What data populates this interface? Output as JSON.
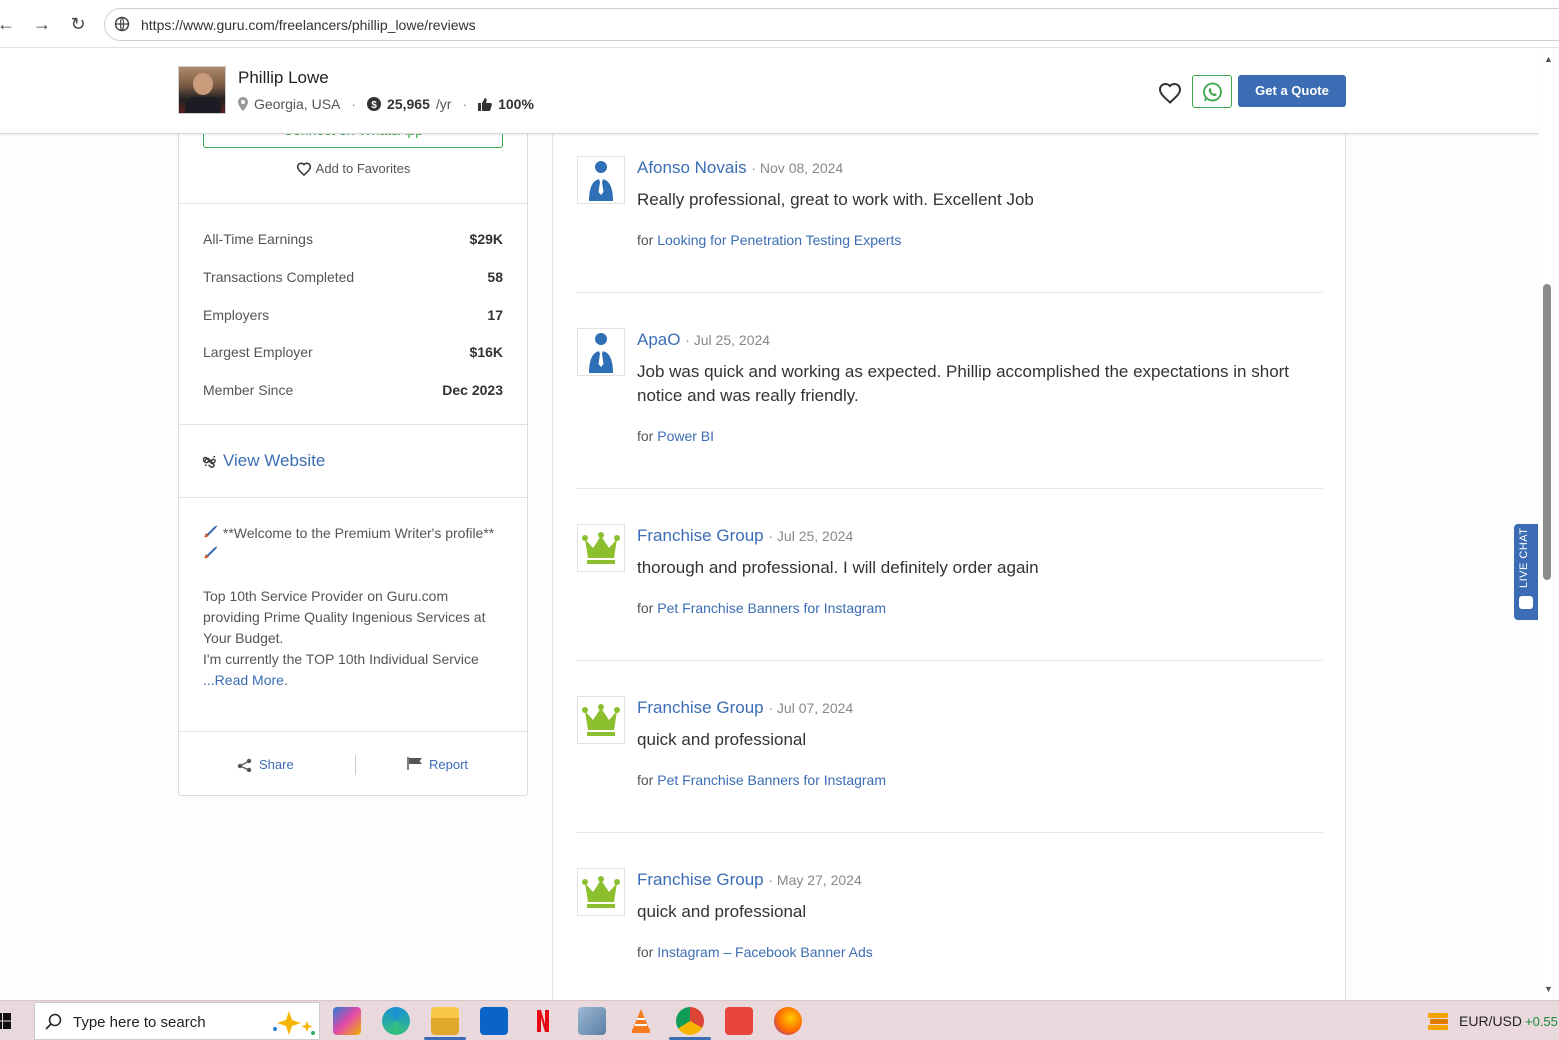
{
  "browser": {
    "url": "https://www.guru.com/freelancers/phillip_lowe/reviews",
    "back_icon": "arrow-left-icon",
    "forward_icon": "arrow-right-icon",
    "reload_icon": "reload-icon"
  },
  "header": {
    "name": "Phillip Lowe",
    "location": "Georgia, USA",
    "earnings": "25,965",
    "earnings_suffix": "/yr",
    "rating": "100%",
    "quote_label": "Get a Quote"
  },
  "sidebar": {
    "whatsapp_label": "Connect on WhatsApp",
    "favorites_label": "Add to Favorites",
    "stats": [
      {
        "label": "All-Time Earnings",
        "value": "$29K"
      },
      {
        "label": "Transactions Completed",
        "value": "58"
      },
      {
        "label": "Employers",
        "value": "17"
      },
      {
        "label": "Largest Employer",
        "value": "$16K"
      },
      {
        "label": "Member Since",
        "value": "Dec 2023"
      }
    ],
    "website_label": "View Website",
    "bio_line1": "**Welcome to the Premium Writer's profile**",
    "bio_body": "Top 10th Service Provider on Guru.com providing Prime Quality Ingenious Services at Your Budget.",
    "bio_body2": "I'm currently the TOP 10th Individual Service",
    "bio_ellipsis": "...",
    "read_more": "Read More",
    "share_label": "Share",
    "report_label": "Report"
  },
  "reviews": [
    {
      "name": "Afonso Novais",
      "date": "· Nov 08, 2024",
      "text": "Really professional, great to work with. Excellent Job",
      "for_prefix": "for",
      "job": "Looking for Penetration Testing Experts",
      "avatar": "user-icon"
    },
    {
      "name": "ApaO",
      "date": "· Jul 25, 2024",
      "text": "Job was quick and working as expected. Phillip accomplished the expectations in short notice and was really friendly.",
      "for_prefix": "for",
      "job": "Power BI",
      "avatar": "user-icon"
    },
    {
      "name": "Franchise Group",
      "date": "· Jul 25, 2024",
      "text": "thorough and professional. I will definitely order again",
      "for_prefix": "for",
      "job": "Pet Franchise Banners for Instagram",
      "avatar": "crown-icon"
    },
    {
      "name": "Franchise Group",
      "date": "· Jul 07, 2024",
      "text": "quick and professional",
      "for_prefix": "for",
      "job": "Pet Franchise Banners for Instagram",
      "avatar": "crown-icon"
    },
    {
      "name": "Franchise Group",
      "date": "· May 27, 2024",
      "text": "quick and professional",
      "for_prefix": "for",
      "job": "Instagram – Facebook Banner Ads",
      "avatar": "crown-icon"
    }
  ],
  "live_chat": {
    "label": "LIVE CHAT"
  },
  "taskbar": {
    "search_placeholder": "Type here to search",
    "fx_pair": "EUR/USD",
    "fx_change": "+0.55"
  },
  "colors": {
    "accent": "#3c6db4",
    "whatsapp": "#3aa64a",
    "crown": "#8bbf2e"
  }
}
